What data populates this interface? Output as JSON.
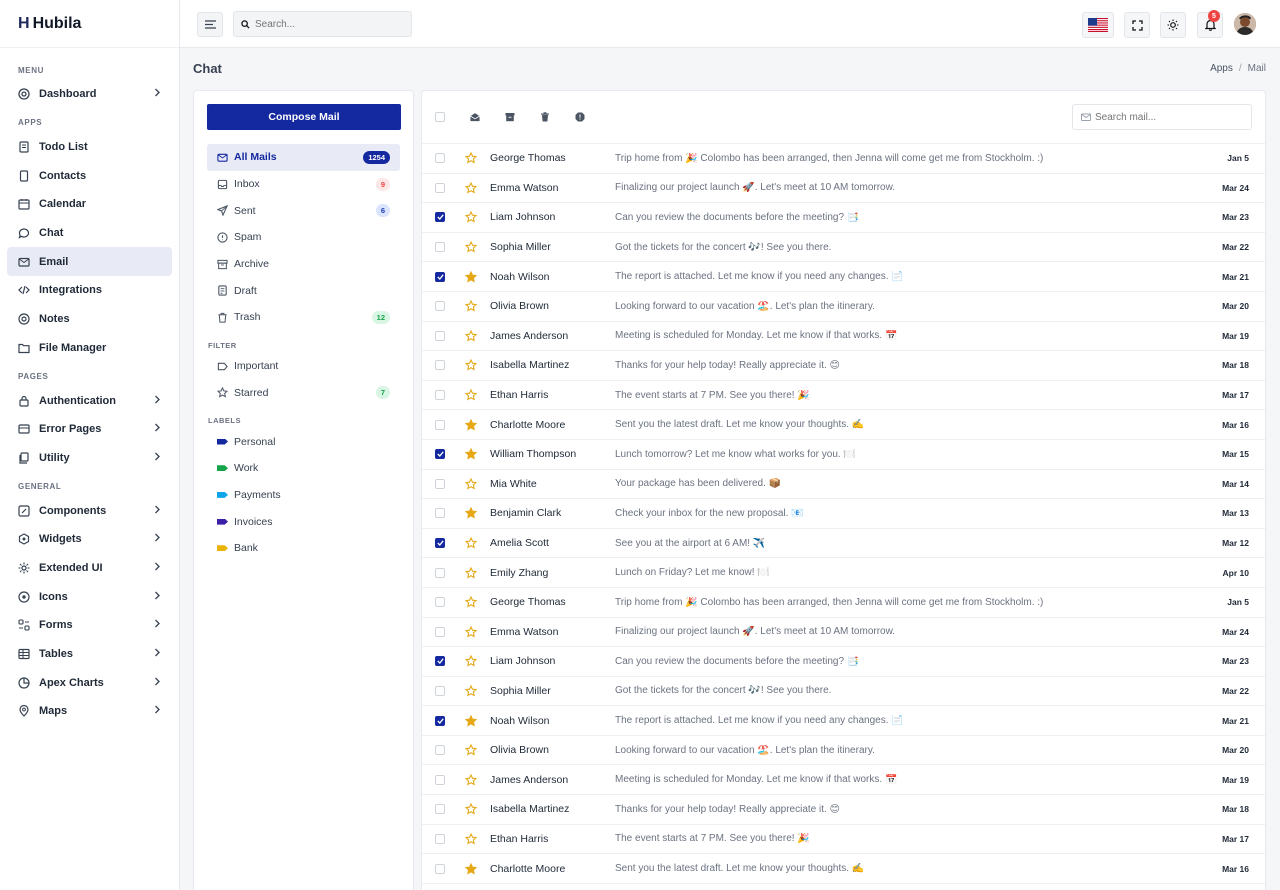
{
  "brand": {
    "mark": "H",
    "name": "Hubila"
  },
  "sidebar": {
    "sections": [
      {
        "title": "MENU",
        "items": [
          {
            "label": "Dashboard",
            "icon": "dashboard-icon",
            "chevron": true
          }
        ]
      },
      {
        "title": "APPS",
        "items": [
          {
            "label": "Todo List",
            "icon": "todo-icon",
            "chevron": false
          },
          {
            "label": "Contacts",
            "icon": "contacts-icon",
            "chevron": false
          },
          {
            "label": "Calendar",
            "icon": "calendar-icon",
            "chevron": false
          },
          {
            "label": "Chat",
            "icon": "chat-icon",
            "chevron": false
          },
          {
            "label": "Email",
            "icon": "email-icon",
            "chevron": false,
            "active": true
          },
          {
            "label": "Integrations",
            "icon": "code-icon",
            "chevron": false
          },
          {
            "label": "Notes",
            "icon": "notes-icon",
            "chevron": false
          },
          {
            "label": "File Manager",
            "icon": "folder-icon",
            "chevron": false
          }
        ]
      },
      {
        "title": "PAGES",
        "items": [
          {
            "label": "Authentication",
            "icon": "lock-icon",
            "chevron": true
          },
          {
            "label": "Error Pages",
            "icon": "error-icon",
            "chevron": true
          },
          {
            "label": "Utility",
            "icon": "utility-icon",
            "chevron": true
          }
        ]
      },
      {
        "title": "GENERAL",
        "items": [
          {
            "label": "Components",
            "icon": "components-icon",
            "chevron": true
          },
          {
            "label": "Widgets",
            "icon": "widgets-icon",
            "chevron": true
          },
          {
            "label": "Extended UI",
            "icon": "extended-icon",
            "chevron": true
          },
          {
            "label": "Icons",
            "icon": "icons-icon",
            "chevron": true
          },
          {
            "label": "Forms",
            "icon": "forms-icon",
            "chevron": true
          },
          {
            "label": "Tables",
            "icon": "tables-icon",
            "chevron": true
          },
          {
            "label": "Apex Charts",
            "icon": "charts-icon",
            "chevron": true
          },
          {
            "label": "Maps",
            "icon": "map-pin-icon",
            "chevron": true
          }
        ]
      }
    ]
  },
  "topbar": {
    "search_placeholder": "Search...",
    "notification_count": "5"
  },
  "page": {
    "title": "Chat",
    "breadcrumb": [
      "Apps",
      "Mail"
    ]
  },
  "mail_sidebar": {
    "compose_label": "Compose Mail",
    "folders": [
      {
        "label": "All Mails",
        "icon": "mail-icon",
        "count": "1254",
        "badge": "navy",
        "active": true
      },
      {
        "label": "Inbox",
        "icon": "inbox-icon",
        "count": "9",
        "badge": "red"
      },
      {
        "label": "Sent",
        "icon": "send-icon",
        "count": "6",
        "badge": "blue"
      },
      {
        "label": "Spam",
        "icon": "spam-icon",
        "count": "",
        "badge": ""
      },
      {
        "label": "Archive",
        "icon": "archive-icon",
        "count": "",
        "badge": ""
      },
      {
        "label": "Draft",
        "icon": "draft-icon",
        "count": "",
        "badge": ""
      },
      {
        "label": "Trash",
        "icon": "trash-icon",
        "count": "12",
        "badge": "green"
      }
    ],
    "filter_title": "FILTER",
    "filters": [
      {
        "label": "Important",
        "icon": "important-icon",
        "count": "",
        "badge": ""
      },
      {
        "label": "Starred",
        "icon": "star-icon",
        "count": "7",
        "badge": "green"
      }
    ],
    "labels_title": "LABELS",
    "labels": [
      {
        "label": "Personal",
        "color": "#1428a0"
      },
      {
        "label": "Work",
        "color": "#16a34a"
      },
      {
        "label": "Payments",
        "color": "#0ea5e9"
      },
      {
        "label": "Invoices",
        "color": "#3b1fa8"
      },
      {
        "label": "Bank",
        "color": "#eab308"
      }
    ]
  },
  "mail_list": {
    "search_placeholder": "Search mail...",
    "rows": [
      {
        "sender": "George Thomas",
        "subject": "Trip home from 🎉 Colombo has been arranged, then Jenna will come get me from Stockholm. :)",
        "date": "Jan 5",
        "checked": false,
        "starred": false
      },
      {
        "sender": "Emma Watson",
        "subject": "Finalizing our project launch 🚀. Let's meet at 10 AM tomorrow.",
        "date": "Mar 24",
        "checked": false,
        "starred": false
      },
      {
        "sender": "Liam Johnson",
        "subject": "Can you review the documents before the meeting? 📑",
        "date": "Mar 23",
        "checked": true,
        "starred": false
      },
      {
        "sender": "Sophia Miller",
        "subject": "Got the tickets for the concert 🎶! See you there.",
        "date": "Mar 22",
        "checked": false,
        "starred": false
      },
      {
        "sender": "Noah Wilson",
        "subject": "The report is attached. Let me know if you need any changes. 📄",
        "date": "Mar 21",
        "checked": true,
        "starred": true
      },
      {
        "sender": "Olivia Brown",
        "subject": "Looking forward to our vacation 🏖️. Let's plan the itinerary.",
        "date": "Mar 20",
        "checked": false,
        "starred": false
      },
      {
        "sender": "James Anderson",
        "subject": "Meeting is scheduled for Monday. Let me know if that works. 📅",
        "date": "Mar 19",
        "checked": false,
        "starred": false
      },
      {
        "sender": "Isabella Martinez",
        "subject": "Thanks for your help today! Really appreciate it. 😊",
        "date": "Mar 18",
        "checked": false,
        "starred": false
      },
      {
        "sender": "Ethan Harris",
        "subject": "The event starts at 7 PM. See you there! 🎉",
        "date": "Mar 17",
        "checked": false,
        "starred": false
      },
      {
        "sender": "Charlotte Moore",
        "subject": "Sent you the latest draft. Let me know your thoughts. ✍️",
        "date": "Mar 16",
        "checked": false,
        "starred": true
      },
      {
        "sender": "William Thompson",
        "subject": "Lunch tomorrow? Let me know what works for you. 🍽️",
        "date": "Mar 15",
        "checked": true,
        "starred": true
      },
      {
        "sender": "Mia White",
        "subject": "Your package has been delivered. 📦",
        "date": "Mar 14",
        "checked": false,
        "starred": false
      },
      {
        "sender": "Benjamin Clark",
        "subject": "Check your inbox for the new proposal. 📧",
        "date": "Mar 13",
        "checked": false,
        "starred": true
      },
      {
        "sender": "Amelia Scott",
        "subject": "See you at the airport at 6 AM! ✈️",
        "date": "Mar 12",
        "checked": true,
        "starred": false
      },
      {
        "sender": "Emily Zhang",
        "subject": "Lunch on Friday? Let me know! 🍽️",
        "date": "Apr 10",
        "checked": false,
        "starred": false
      },
      {
        "sender": "George Thomas",
        "subject": "Trip home from 🎉 Colombo has been arranged, then Jenna will come get me from Stockholm. :)",
        "date": "Jan 5",
        "checked": false,
        "starred": false
      },
      {
        "sender": "Emma Watson",
        "subject": "Finalizing our project launch 🚀. Let's meet at 10 AM tomorrow.",
        "date": "Mar 24",
        "checked": false,
        "starred": false
      },
      {
        "sender": "Liam Johnson",
        "subject": "Can you review the documents before the meeting? 📑",
        "date": "Mar 23",
        "checked": true,
        "starred": false
      },
      {
        "sender": "Sophia Miller",
        "subject": "Got the tickets for the concert 🎶! See you there.",
        "date": "Mar 22",
        "checked": false,
        "starred": false
      },
      {
        "sender": "Noah Wilson",
        "subject": "The report is attached. Let me know if you need any changes. 📄",
        "date": "Mar 21",
        "checked": true,
        "starred": true
      },
      {
        "sender": "Olivia Brown",
        "subject": "Looking forward to our vacation 🏖️. Let's plan the itinerary.",
        "date": "Mar 20",
        "checked": false,
        "starred": false
      },
      {
        "sender": "James Anderson",
        "subject": "Meeting is scheduled for Monday. Let me know if that works. 📅",
        "date": "Mar 19",
        "checked": false,
        "starred": false
      },
      {
        "sender": "Isabella Martinez",
        "subject": "Thanks for your help today! Really appreciate it. 😊",
        "date": "Mar 18",
        "checked": false,
        "starred": false
      },
      {
        "sender": "Ethan Harris",
        "subject": "The event starts at 7 PM. See you there! 🎉",
        "date": "Mar 17",
        "checked": false,
        "starred": false
      },
      {
        "sender": "Charlotte Moore",
        "subject": "Sent you the latest draft. Let me know your thoughts. ✍️",
        "date": "Mar 16",
        "checked": false,
        "starred": true
      }
    ]
  },
  "colors": {
    "accent": "#1428a0",
    "star": "#e6a817"
  }
}
